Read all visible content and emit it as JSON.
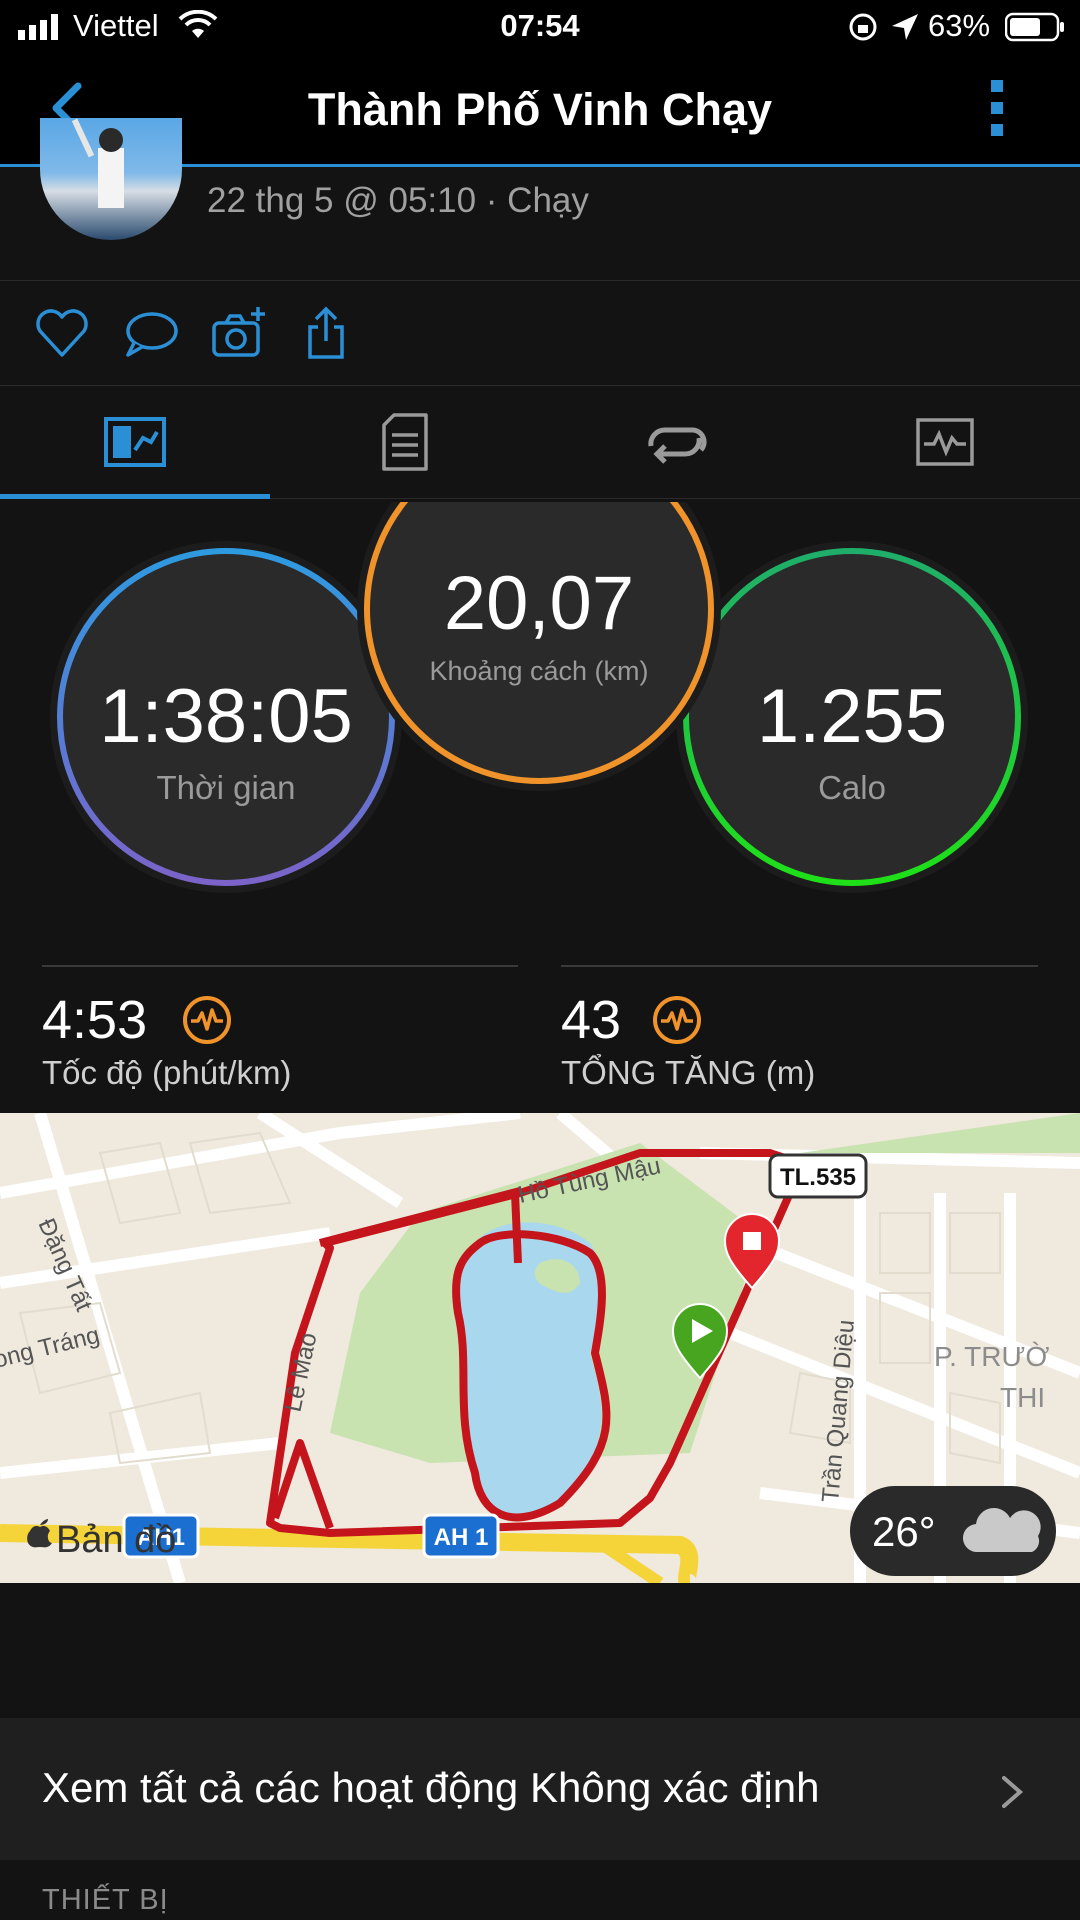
{
  "status_bar": {
    "carrier": "Viettel",
    "time": "07:54",
    "battery": "63%"
  },
  "nav": {
    "title": "Thành Phố Vinh Chạy"
  },
  "activity": {
    "subtitle": "22 thg 5 @ 05:10 · Chạy"
  },
  "tabs": [
    "overview",
    "details",
    "laps",
    "charts"
  ],
  "stats": {
    "time": {
      "value": "1:38:05",
      "label": "Thời gian"
    },
    "distance": {
      "value": "20,07",
      "label": "Khoảng cách (km)"
    },
    "calories": {
      "value": "1.255",
      "label": "Calo"
    }
  },
  "metrics": {
    "pace": {
      "value": "4:53",
      "label": "Tốc độ (phút/km)"
    },
    "elevation": {
      "value": "43",
      "label": "TỔNG TĂNG (m)"
    }
  },
  "map": {
    "labels": {
      "road1": "Hồ Tùng Mậu",
      "road2": "Lê Mao",
      "road3": "Đặng Tất",
      "road4": "ong Tráng",
      "road5": "Trần Quang Diệu",
      "area1": "P. TRƯỜ",
      "area2": "THI"
    },
    "badges": {
      "tl": "TL.535",
      "ah1": "AH 1",
      "ah1b": "AH1"
    },
    "attribution": "Bản đồ",
    "weather": {
      "temp": "26°"
    },
    "colors": {
      "route": "#c4151c",
      "park": "#c8e2b0",
      "water": "#a9d7ee",
      "road_major": "#f5d43a"
    }
  },
  "link_row": {
    "label": "Xem tất cả các hoạt động Không xác định"
  },
  "section": {
    "title": "THIẾT BỊ"
  }
}
